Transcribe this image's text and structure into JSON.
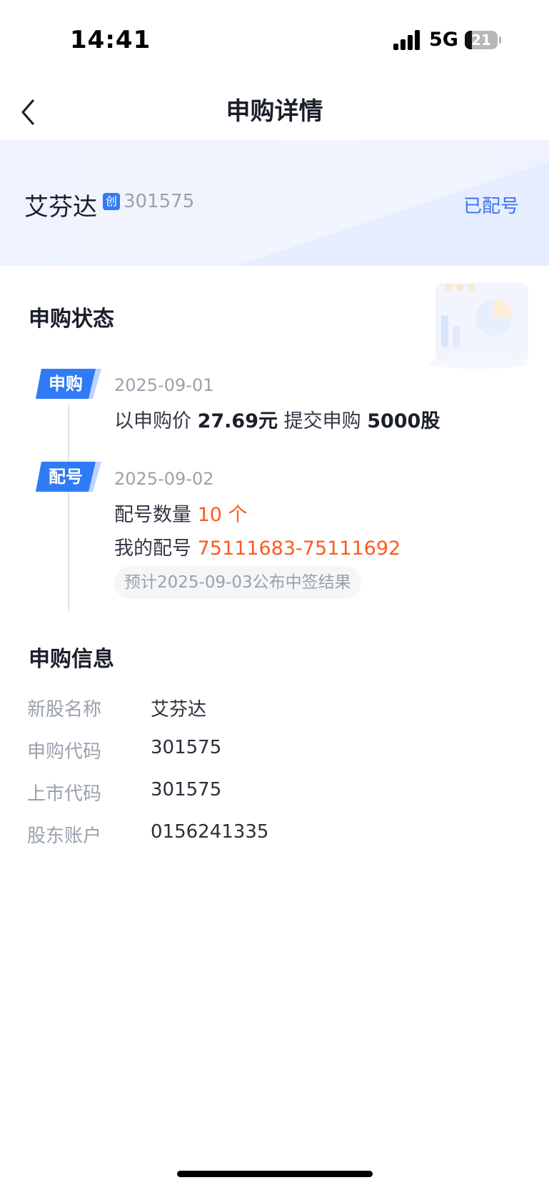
{
  "status_bar": {
    "time": "14:41",
    "network": "5G",
    "battery": 21
  },
  "nav": {
    "title": "申购详情",
    "back_icon": "chevron-left-icon"
  },
  "stock": {
    "name": "艾芬达",
    "board_badge": "创",
    "code": "301575",
    "status": "已配号"
  },
  "subscription_status": {
    "title": "申购状态",
    "steps": [
      {
        "tag": "申购",
        "date": "2025-09-01",
        "line": {
          "prefix": "以申购价",
          "price": "27.69元",
          "middle": "提交申购",
          "shares": "5000股"
        }
      },
      {
        "tag": "配号",
        "date": "2025-09-02",
        "count_label": "配号数量",
        "count_value": "10 个",
        "numbers_label": "我的配号",
        "numbers_value": "75111683-75111692",
        "note": "预计2025-09-03公布中签结果"
      }
    ]
  },
  "subscription_info": {
    "title": "申购信息",
    "rows": [
      {
        "label": "新股名称",
        "value": "艾芬达"
      },
      {
        "label": "申购代码",
        "value": "301575"
      },
      {
        "label": "上市代码",
        "value": "301575"
      },
      {
        "label": "股东账户",
        "value": "0156241335"
      }
    ]
  },
  "colors": {
    "accent": "#2f7bf5",
    "link": "#3a74f0",
    "highlight": "#ff5a1f",
    "header_bg": "#eef3ff"
  }
}
